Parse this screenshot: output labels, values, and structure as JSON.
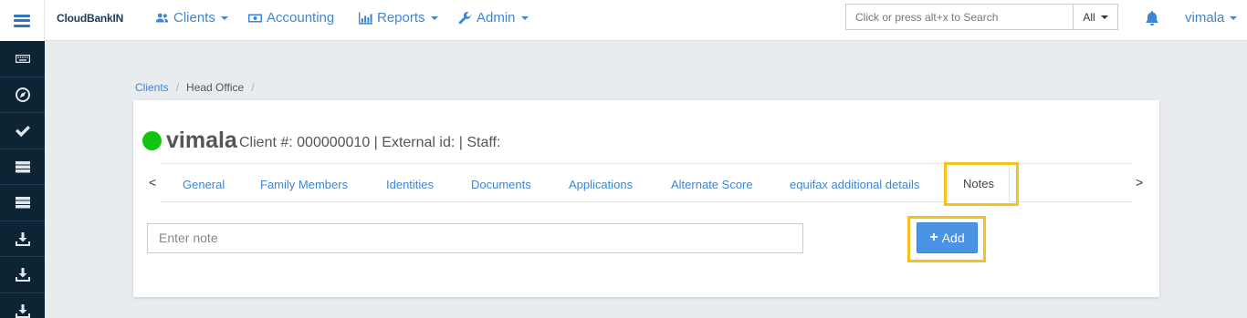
{
  "header": {
    "brand": "CloudBankIN",
    "nav": {
      "clients": "Clients",
      "accounting": "Accounting",
      "reports": "Reports",
      "admin": "Admin"
    },
    "search": {
      "placeholder": "Click or press alt+x to Search",
      "scope": "All"
    },
    "user": "vimala"
  },
  "sidebar": {
    "icons": [
      "keyboard-icon",
      "compass-icon",
      "check-icon",
      "server-icon",
      "server-icon",
      "download-icon",
      "download-icon",
      "download-icon"
    ]
  },
  "breadcrumb": {
    "items": [
      "Clients",
      "Head Office"
    ],
    "separator": "/"
  },
  "client": {
    "name": "vimala",
    "meta": "Client #: 000000010 | External id: | Staff:",
    "status_color": "#12c412"
  },
  "tabs": {
    "prev": "<",
    "next": ">",
    "items": [
      "General",
      "Family Members",
      "Identities",
      "Documents",
      "Applications",
      "Alternate Score",
      "equifax additional details",
      "Notes"
    ],
    "active": "Notes"
  },
  "notes": {
    "input_placeholder": "Enter note",
    "add_label": "Add"
  },
  "colors": {
    "accent": "#3d86d4",
    "highlight": "#f5c320",
    "sidebar": "#0d2434",
    "button": "#4a94e6"
  }
}
